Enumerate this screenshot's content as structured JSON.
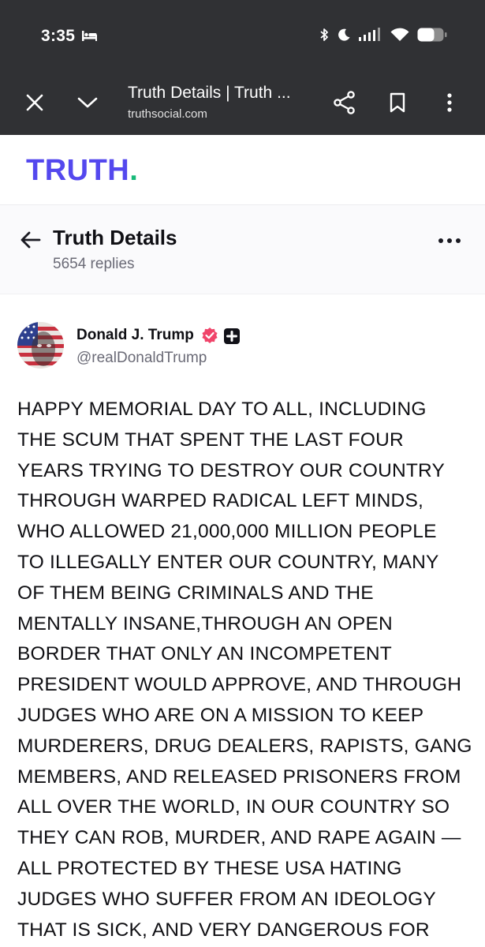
{
  "status_bar": {
    "time": "3:35",
    "icons": [
      "bed-icon",
      "bluetooth-icon",
      "do-not-disturb-moon-icon",
      "signal-icon",
      "wifi-icon",
      "battery-icon"
    ]
  },
  "browser": {
    "page_title": "Truth Details | Truth ...",
    "url": "truthsocial.com",
    "icons": [
      "close-icon",
      "chevron-down-icon",
      "share-icon",
      "bookmark-icon",
      "more-vertical-icon"
    ]
  },
  "site": {
    "logo_text": "TRUTH",
    "logo_dot": ".",
    "logo_color": "#5448ee",
    "logo_dot_color": "#17b978"
  },
  "details": {
    "title": "Truth Details",
    "replies": "5654 replies"
  },
  "post": {
    "author_name": "Donald J. Trump",
    "handle": "@realDonaldTrump",
    "verified_color": "#f0446a",
    "body_lines": [
      "HAPPY MEMORIAL DAY TO ALL, INCLUDING",
      "THE SCUM THAT SPENT THE LAST FOUR",
      "YEARS TRYING TO DESTROY OUR COUNTRY",
      "THROUGH WARPED RADICAL LEFT MINDS,",
      "WHO ALLOWED 21,000,000 MILLION PEOPLE",
      "TO ILLEGALLY ENTER OUR COUNTRY, MANY",
      "OF THEM BEING CRIMINALS AND THE",
      "MENTALLY INSANE,THROUGH AN OPEN",
      "BORDER THAT ONLY AN INCOMPETENT",
      "PRESIDENT WOULD APPROVE, AND THROUGH",
      "JUDGES WHO ARE ON A MISSION TO KEEP",
      "MURDERERS, DRUG DEALERS, RAPISTS, GANG",
      "MEMBERS, AND RELEASED PRISONERS FROM",
      "ALL OVER THE WORLD, IN OUR COUNTRY SO",
      "THEY CAN ROB, MURDER, AND RAPE AGAIN —",
      "ALL PROTECTED BY THESE USA HATING",
      "JUDGES WHO SUFFER FROM AN IDEOLOGY",
      "THAT IS SICK, AND VERY DANGEROUS FOR"
    ]
  }
}
